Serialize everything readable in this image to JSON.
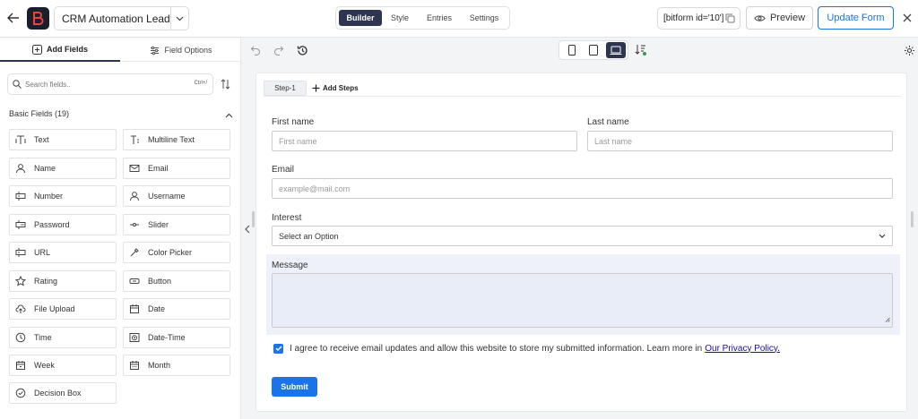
{
  "header": {
    "form_title": "CRM Automation Lead F...",
    "tabs": [
      {
        "label": "Builder",
        "active": true
      },
      {
        "label": "Style",
        "active": false
      },
      {
        "label": "Entries",
        "active": false
      },
      {
        "label": "Settings",
        "active": false
      }
    ],
    "shortcode": "[bitform id='10']",
    "preview_label": "Preview",
    "update_label": "Update Form"
  },
  "left_panel": {
    "tabs": [
      {
        "label": "Add Fields",
        "icon": "plus-square-icon",
        "active": true
      },
      {
        "label": "Field Options",
        "icon": "sliders-icon",
        "active": false
      }
    ],
    "search_placeholder": "Search fields..",
    "search_shortcut": "Ctrl+/",
    "section_title": "Basic Fields (19)",
    "fields": [
      {
        "label": "Text",
        "icon": "text-field-icon"
      },
      {
        "label": "Multiline Text",
        "icon": "multiline-text-icon"
      },
      {
        "label": "Name",
        "icon": "user-icon"
      },
      {
        "label": "Email",
        "icon": "email-icon"
      },
      {
        "label": "Number",
        "icon": "number-icon"
      },
      {
        "label": "Username",
        "icon": "user-icon"
      },
      {
        "label": "Password",
        "icon": "password-icon"
      },
      {
        "label": "Slider",
        "icon": "slider-icon"
      },
      {
        "label": "URL",
        "icon": "url-icon"
      },
      {
        "label": "Color Picker",
        "icon": "color-picker-icon"
      },
      {
        "label": "Rating",
        "icon": "star-icon"
      },
      {
        "label": "Button",
        "icon": "button-icon"
      },
      {
        "label": "File Upload",
        "icon": "upload-icon"
      },
      {
        "label": "Date",
        "icon": "calendar-icon"
      },
      {
        "label": "Time",
        "icon": "clock-icon"
      },
      {
        "label": "Date-Time",
        "icon": "datetime-icon"
      },
      {
        "label": "Week",
        "icon": "calendar-week-icon"
      },
      {
        "label": "Month",
        "icon": "calendar-month-icon"
      },
      {
        "label": "Decision Box",
        "icon": "check-circle-icon"
      }
    ]
  },
  "toolbar": {
    "device_active": "desktop"
  },
  "canvas": {
    "step_label": "Step-1",
    "add_steps_label": "Add Steps",
    "first_name_label": "First name",
    "first_name_placeholder": "First name",
    "last_name_label": "Last name",
    "last_name_placeholder": "Last name",
    "email_label": "Email",
    "email_placeholder": "example@mail.com",
    "interest_label": "Interest",
    "interest_value": "Select an Option",
    "message_label": "Message",
    "consent_text": "I agree to receive email updates and allow this website to store my submitted information. Learn more in",
    "consent_link": "Our Privacy Policy.",
    "submit_label": "Submit"
  },
  "colors": {
    "accent": "#1a73e8",
    "dark": "#2d3550"
  }
}
